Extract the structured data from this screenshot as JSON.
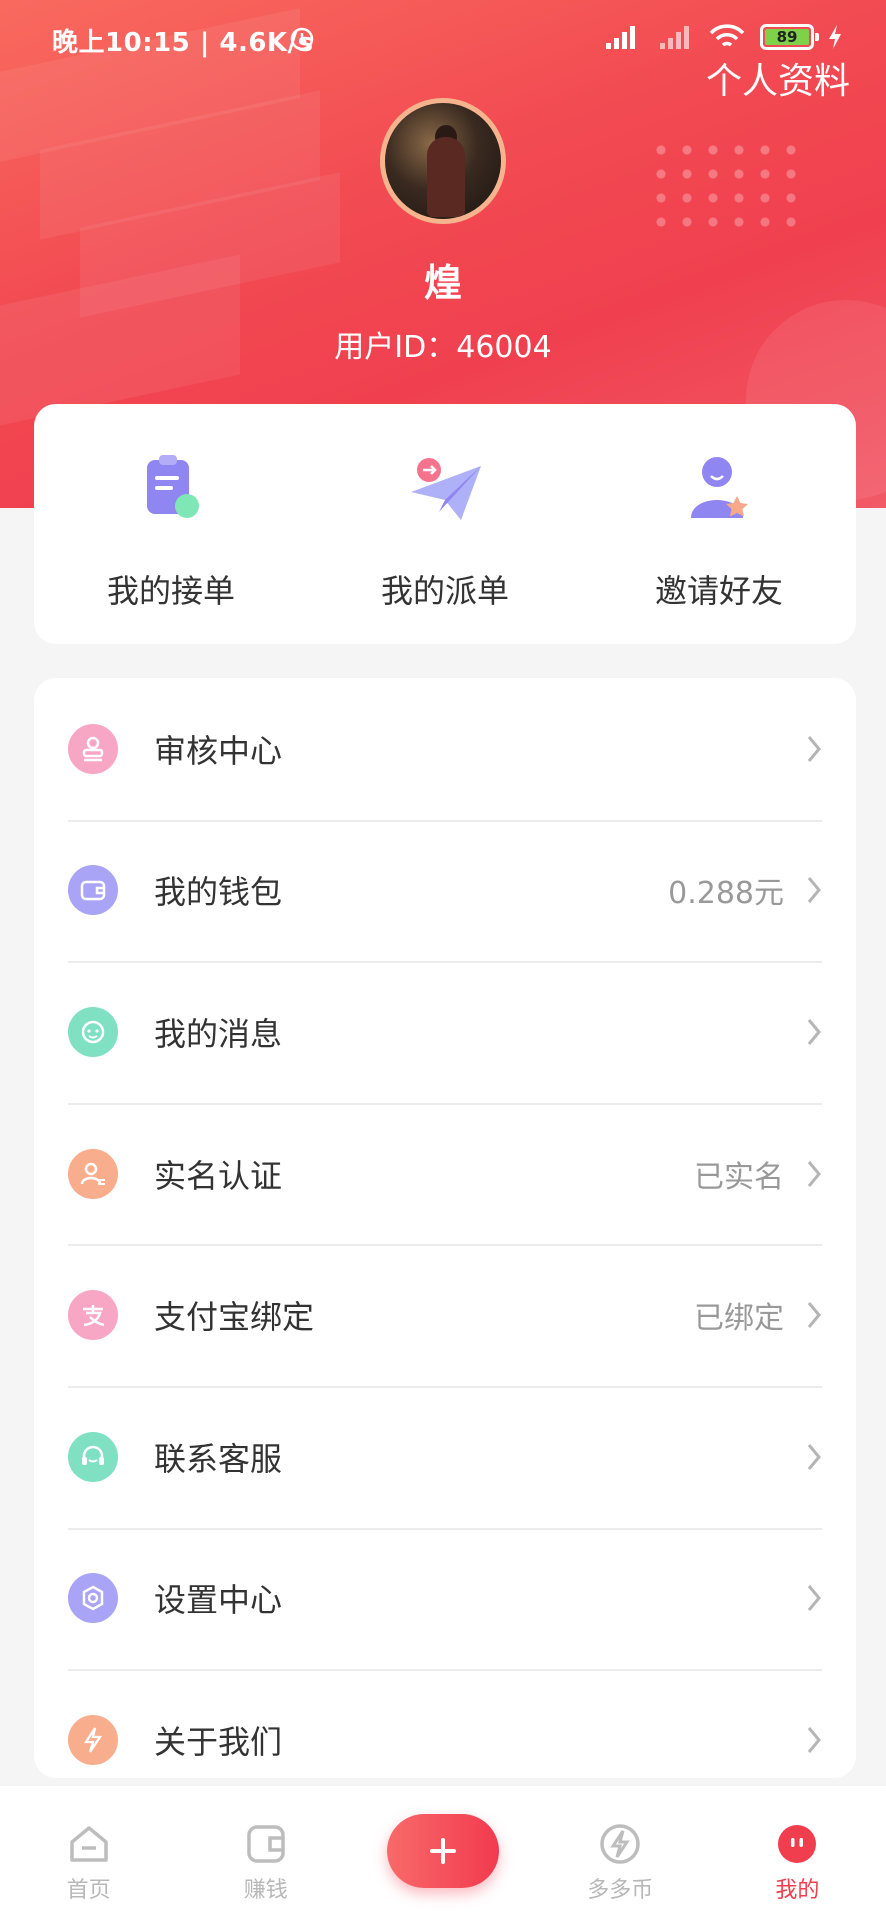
{
  "status_bar": {
    "time": "晚上10:15 | 4.6K/s",
    "battery": "89"
  },
  "header": {
    "profile_link": "个人资料",
    "username": "煌",
    "user_id": "用户ID：46004"
  },
  "quick_actions": [
    {
      "label": "我的接单",
      "icon": "clipboard-icon"
    },
    {
      "label": "我的派单",
      "icon": "paper-plane-icon"
    },
    {
      "label": "邀请好友",
      "icon": "invite-friend-icon"
    }
  ],
  "menu": [
    {
      "label": "审核中心",
      "value": "",
      "icon": "stamp-icon",
      "color": "#f7a6c4"
    },
    {
      "label": "我的钱包",
      "value": "0.288元",
      "icon": "wallet-icon",
      "color": "#a9a4f5"
    },
    {
      "label": "我的消息",
      "value": "",
      "icon": "message-icon",
      "color": "#7fe0c2"
    },
    {
      "label": "实名认证",
      "value": "已实名",
      "icon": "id-user-icon",
      "color": "#f8ad8c"
    },
    {
      "label": "支付宝绑定",
      "value": "已绑定",
      "icon": "alipay-icon",
      "color": "#f7a6c4"
    },
    {
      "label": "联系客服",
      "value": "",
      "icon": "headset-icon",
      "color": "#7fe0c2"
    },
    {
      "label": "设置中心",
      "value": "",
      "icon": "settings-icon",
      "color": "#a9a4f5"
    },
    {
      "label": "关于我们",
      "value": "",
      "icon": "lightning-icon",
      "color": "#f8ad8c"
    }
  ],
  "tabbar": [
    {
      "label": "首页",
      "icon": "home-icon"
    },
    {
      "label": "赚钱",
      "icon": "wallet-tab-icon"
    },
    {
      "label": "",
      "icon": "plus-icon"
    },
    {
      "label": "多多币",
      "icon": "coin-icon"
    },
    {
      "label": "我的",
      "icon": "profile-tab-icon",
      "active": true
    }
  ],
  "colors": {
    "brand": "#f03e4e",
    "header_start": "#f96a5e"
  }
}
